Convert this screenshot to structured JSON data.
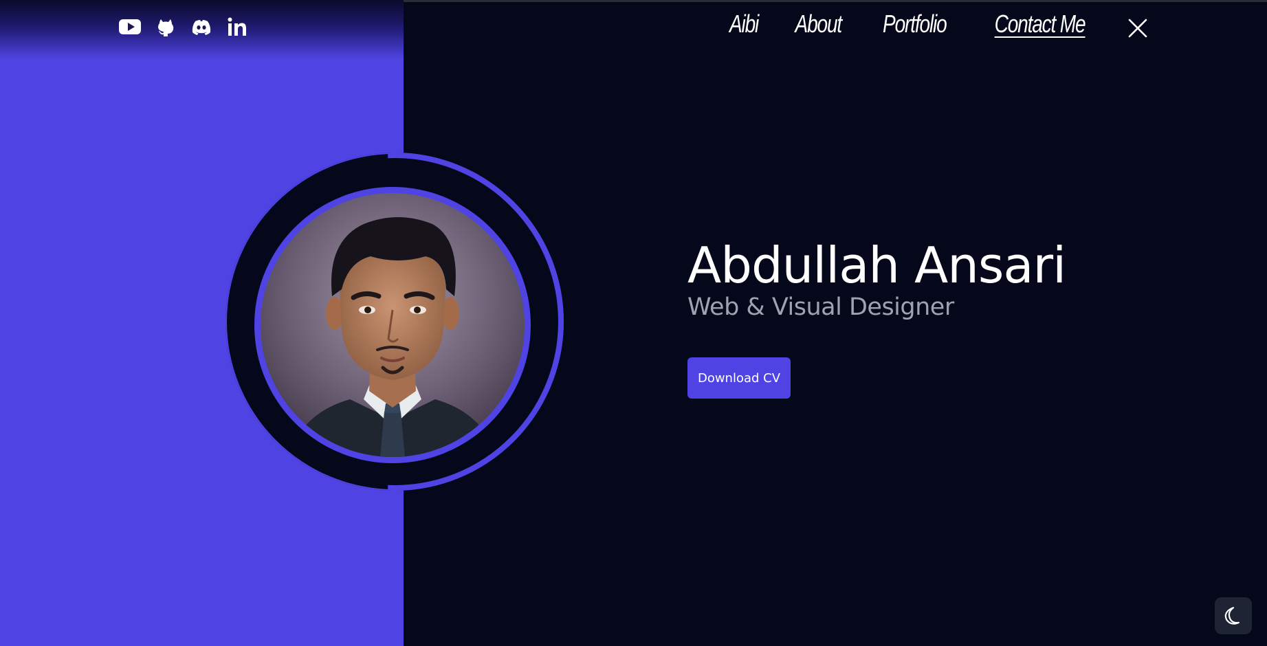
{
  "social": {
    "links": [
      {
        "icon": "youtube-icon"
      },
      {
        "icon": "github-icon"
      },
      {
        "icon": "discord-icon"
      },
      {
        "icon": "linkedin-icon"
      }
    ]
  },
  "nav": {
    "items": [
      {
        "label": "Aibi"
      },
      {
        "label": "About"
      },
      {
        "label": "Portfolio"
      },
      {
        "label": "Contact Me",
        "active": true
      }
    ],
    "close_icon": "close-icon"
  },
  "hero": {
    "name": "Abdullah Ansari",
    "role": "Web & Visual Designer",
    "cta_label": "Download CV"
  },
  "theme_toggle": {
    "icon": "moon-icon"
  },
  "colors": {
    "accent": "#4f43e3",
    "background": "#04081a",
    "text": "#ffffff",
    "muted": "#9ea3b0"
  }
}
